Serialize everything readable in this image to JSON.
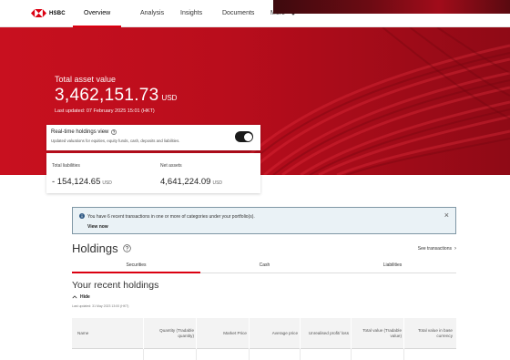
{
  "nav": {
    "brand": "HSBC",
    "items": [
      {
        "label": "Overview",
        "active": true
      },
      {
        "label": "Analysis",
        "active": false
      },
      {
        "label": "Insights",
        "active": false
      },
      {
        "label": "Documents",
        "active": false
      },
      {
        "label": "More",
        "active": false
      }
    ]
  },
  "summary": {
    "total_label": "Total asset value",
    "total_value": "3,462,151.73",
    "total_currency": "USD",
    "last_updated": "Last updated: 07 February 2025 15:01 (HKT)"
  },
  "realtime": {
    "title": "Real-time holdings view",
    "description": "Updated valuations for equities, equity funds, cash, deposits and liabilities.",
    "enabled": true
  },
  "liabilities": {
    "label": "Total liabilities",
    "value": "- 154,124.65",
    "currency": "USD"
  },
  "net_assets": {
    "label": "Net assets",
    "value": "4,641,224.09",
    "currency": "USD"
  },
  "notice": {
    "text": "You have 6 recent transactions in one or more of categories under your portfolio(s).",
    "link": "View now",
    "close": "×"
  },
  "holdings": {
    "title": "Holdings",
    "see_transactions": "See transactions",
    "tabs": [
      {
        "label": "Securities",
        "active": true
      },
      {
        "label": "Cash",
        "active": false
      },
      {
        "label": "Liabilities",
        "active": false
      }
    ]
  },
  "recent": {
    "title": "Your recent holdings",
    "hide": "Hide",
    "last_updated": "Last updated: 31 May 2023 13:00 (HKT)",
    "columns": [
      "Name",
      "Quantity (Tradable quantity)",
      "Market Price",
      "Average price",
      "Unrealised profit/ loss",
      "Total value (Tradable value)",
      "Total value in base currency"
    ]
  },
  "colors": {
    "brand_red": "#db0011",
    "hero_red": "#c8101f",
    "notice_bg": "#eaf2f6"
  }
}
